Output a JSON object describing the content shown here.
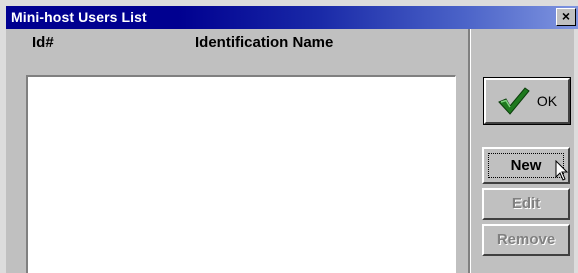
{
  "window": {
    "title": "Mini-host Users List",
    "close_label": "×"
  },
  "list": {
    "columns": [
      "Id#",
      "Identification Name"
    ],
    "rows": []
  },
  "buttons": {
    "ok": "OK",
    "new": "New",
    "edit": "Edit",
    "remove": "Remove"
  },
  "colors": {
    "titlebar": "#000090",
    "face": "#c0c0c0",
    "checkmark": "#1f7a1f"
  },
  "icons": {
    "ok": "checkmark-icon",
    "close": "close-icon",
    "cursor": "arrow-cursor-icon"
  }
}
